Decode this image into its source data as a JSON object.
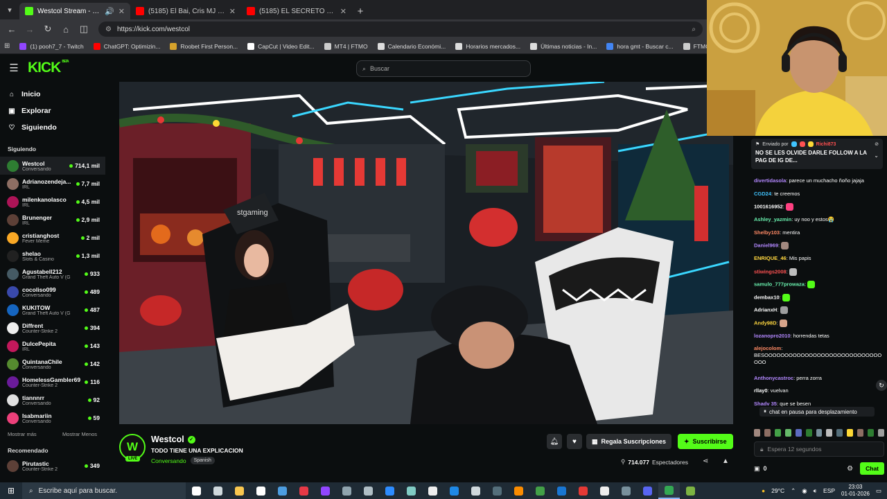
{
  "browser": {
    "tabs": [
      {
        "title": "Westcol Stream - Watch Live",
        "active": true,
        "color": "#53fc18"
      },
      {
        "title": "(5185) El Bai, Cris MJ - Pensándo",
        "active": false,
        "color": "#ff0000"
      },
      {
        "title": "(5185) EL SECRETO FINAL🤑 Cr",
        "active": false,
        "color": "#ff0000"
      }
    ],
    "url": "https://kick.com/westcol",
    "bookmarks": [
      {
        "label": "(1) pooh7_7 - Twitch",
        "color": "#9146ff"
      },
      {
        "label": "ChatGPT: Optimizin...",
        "color": "#ff0000"
      },
      {
        "label": "Roobet First Person...",
        "color": "#d6a22b"
      },
      {
        "label": "CapCut | Video Edit...",
        "color": "#ffffff"
      },
      {
        "label": "MT4 | FTMO",
        "color": "#cccccc"
      },
      {
        "label": "Calendario Económi...",
        "color": "#dddddd"
      },
      {
        "label": "Horarios mercados...",
        "color": "#dddddd"
      },
      {
        "label": "Últimas noticias - In...",
        "color": "#dddddd"
      },
      {
        "label": "hora gmt - Buscar c...",
        "color": "#4285f4"
      },
      {
        "label": "FTMO - For Serio",
        "color": "#cccccc"
      }
    ]
  },
  "kick": {
    "logo": "KICK",
    "logo_tag": "BETA",
    "search_placeholder": "Buscar"
  },
  "sidebar": {
    "nav": [
      {
        "label": "Inicio",
        "icon": "home-icon",
        "glyph": "⌂"
      },
      {
        "label": "Explorar",
        "icon": "explore-icon",
        "glyph": "▣"
      },
      {
        "label": "Siguiendo",
        "icon": "heart-icon",
        "glyph": "♡"
      }
    ],
    "following_title": "Siguiendo",
    "channels": [
      {
        "name": "Westcol",
        "category": "Conversando",
        "viewers": "714,1 mil",
        "color": "#2e7d32"
      },
      {
        "name": "Adrianozendeja...",
        "category": "IRL",
        "viewers": "7,7 mil",
        "color": "#8d6e63"
      },
      {
        "name": "milenkanolasco",
        "category": "IRL",
        "viewers": "4,5 mil",
        "color": "#ad1457"
      },
      {
        "name": "Brunenger",
        "category": "IRL",
        "viewers": "2,9 mil",
        "color": "#5d4037"
      },
      {
        "name": "cristianghost",
        "category": "Fever Meme",
        "viewers": "2 mil",
        "color": "#f9a825"
      },
      {
        "name": "shelao",
        "category": "Slots & Casino",
        "viewers": "1,3 mil",
        "color": "#212121"
      },
      {
        "name": "Agustabell212",
        "category": "Grand Theft Auto V (G",
        "viewers": "933",
        "color": "#455a64"
      },
      {
        "name": "cocoliso099",
        "category": "Conversando",
        "viewers": "489",
        "color": "#3949ab"
      },
      {
        "name": "KUKITOW",
        "category": "Grand Theft Auto V (G",
        "viewers": "487",
        "color": "#1565c0"
      },
      {
        "name": "Diffrent",
        "category": "Counter-Strike 2",
        "viewers": "394",
        "color": "#eeeeee"
      },
      {
        "name": "DulcePepita",
        "category": "IRL",
        "viewers": "143",
        "color": "#c2185b"
      },
      {
        "name": "QuintanaChile",
        "category": "Conversando",
        "viewers": "142",
        "color": "#558b2f"
      },
      {
        "name": "HomelessGambler69",
        "category": "Counter-Strike 2",
        "viewers": "116",
        "color": "#6a1b9a"
      },
      {
        "name": "tiannnrr",
        "category": "Conversando",
        "viewers": "92",
        "color": "#e0e0e0"
      },
      {
        "name": "Isabmariin",
        "category": "Conversando",
        "viewers": "59",
        "color": "#ec407a"
      }
    ],
    "show_more": "Mostrar más",
    "show_less": "Mostrar Menos",
    "recommended_title": "Recomendado",
    "recommended": [
      {
        "name": "Pirutastic",
        "category": "Counter-Strike 2",
        "viewers": "349",
        "color": "#5d4037"
      }
    ]
  },
  "stream": {
    "streamer": "Westcol",
    "avatar_letter": "W",
    "live_label": "LIVE",
    "title": "TODO TIENE UNA EXPLICACION",
    "category": "Conversando",
    "language": "Spanish",
    "gift_label": "Regala Suscripciones",
    "subscribe_label": "Suscribirse",
    "viewers": "714.077",
    "viewers_label": "Espectadores"
  },
  "chat": {
    "pinned_by_label": "Enviado por",
    "pinned_user": "Richi873",
    "pinned_message": "NO SE LES OLVIDE DARLE FOLLOW A LA PAG DE IG DE...",
    "messages": [
      {
        "user": "divertidasola",
        "color": "#b388ff",
        "text": "parece un muchacho ñoño jajaja"
      },
      {
        "user": "CGD24",
        "color": "#40c4ff",
        "text": "te creemos"
      },
      {
        "user": "1001616952",
        "color": "#ffffff",
        "text": "",
        "emote": "#ff4081"
      },
      {
        "user": "Ashley_yazmin",
        "color": "#69f0ae",
        "text": "uy noo y estos😭"
      },
      {
        "user": "Shelby103",
        "color": "#ff8a65",
        "text": "mentira"
      },
      {
        "user": "Daniel969",
        "color": "#b388ff",
        "text": "",
        "emote": "#a1887f"
      },
      {
        "user": "ENRIQUE_46",
        "color": "#ffd740",
        "text": "Mis papis"
      },
      {
        "user": "stiwings2008",
        "color": "#ff5252",
        "text": "",
        "emote": "#bdbdbd"
      },
      {
        "user": "samulo_777prowaza",
        "color": "#69f0ae",
        "text": "",
        "emote": "#53fc18"
      },
      {
        "user": "dembax10",
        "color": "#ffffff",
        "text": "",
        "emote": "#53fc18"
      },
      {
        "user": "AdrianxH",
        "color": "#ffffff",
        "text": "",
        "emote": "#9e9e9e"
      },
      {
        "user": "Andy98D",
        "color": "#ffd740",
        "text": "",
        "emote": "#d7a48a"
      },
      {
        "user": "lozanopro2010",
        "color": "#b388ff",
        "text": "horrendas tetas"
      },
      {
        "user": "alejocolom",
        "color": "#ff8a65",
        "text": "BESOOOOOOOOOOOOOOOOOOOOOOOOOOOOOOOO"
      },
      {
        "user": "Anthonycastroc",
        "color": "#b388ff",
        "text": "perra zorra"
      },
      {
        "user": "rllay0",
        "color": "#ffffff",
        "text": "vuelvan"
      },
      {
        "user": "Shadv 35",
        "color": "#b388ff",
        "text": "que se besen"
      }
    ],
    "paused_label": "chat en pausa para desplazamiento",
    "input_placeholder": "Espera 12 segundos",
    "points": "0",
    "send_label": "Chat"
  },
  "taskbar": {
    "search_placeholder": "Escribe aquí para buscar.",
    "apps": [
      {
        "name": "cortana-icon",
        "color": "#ffffff"
      },
      {
        "name": "task-view-icon",
        "color": "#cfd8dc"
      },
      {
        "name": "file-explorer-icon",
        "color": "#f9c74f"
      },
      {
        "name": "file-icon",
        "color": "#ffffff"
      },
      {
        "name": "office-icon",
        "color": "#4d9de0"
      },
      {
        "name": "app-red-icon",
        "color": "#e63946"
      },
      {
        "name": "twitch-icon",
        "color": "#9146ff"
      },
      {
        "name": "app-icon",
        "color": "#90a4ae"
      },
      {
        "name": "app-icon-2",
        "color": "#b0bec5"
      },
      {
        "name": "zoom-icon",
        "color": "#2d8cff"
      },
      {
        "name": "app-icon-3",
        "color": "#80cbc4"
      },
      {
        "name": "capcut-icon",
        "color": "#eeeeee"
      },
      {
        "name": "app-icon-4",
        "color": "#1e88e5"
      },
      {
        "name": "settings-icon",
        "color": "#cfd8dc"
      },
      {
        "name": "app-icon-5",
        "color": "#546e7a"
      },
      {
        "name": "app-orange-icon",
        "color": "#fb8c00"
      },
      {
        "name": "minecraft-icon",
        "color": "#43a047"
      },
      {
        "name": "steam-icon",
        "color": "#1976d2"
      },
      {
        "name": "opera-icon",
        "color": "#e53935"
      },
      {
        "name": "tiktok-icon",
        "color": "#eeeeee"
      },
      {
        "name": "obs-icon",
        "color": "#78909c"
      },
      {
        "name": "discord-icon",
        "color": "#5865f2"
      },
      {
        "name": "chrome-icon",
        "color": "#34a853",
        "active": true
      },
      {
        "name": "app-green-icon",
        "color": "#7cb342"
      }
    ],
    "weather": "29°C",
    "language": "ESP",
    "time": "23:03",
    "date": "01-01-2026"
  }
}
